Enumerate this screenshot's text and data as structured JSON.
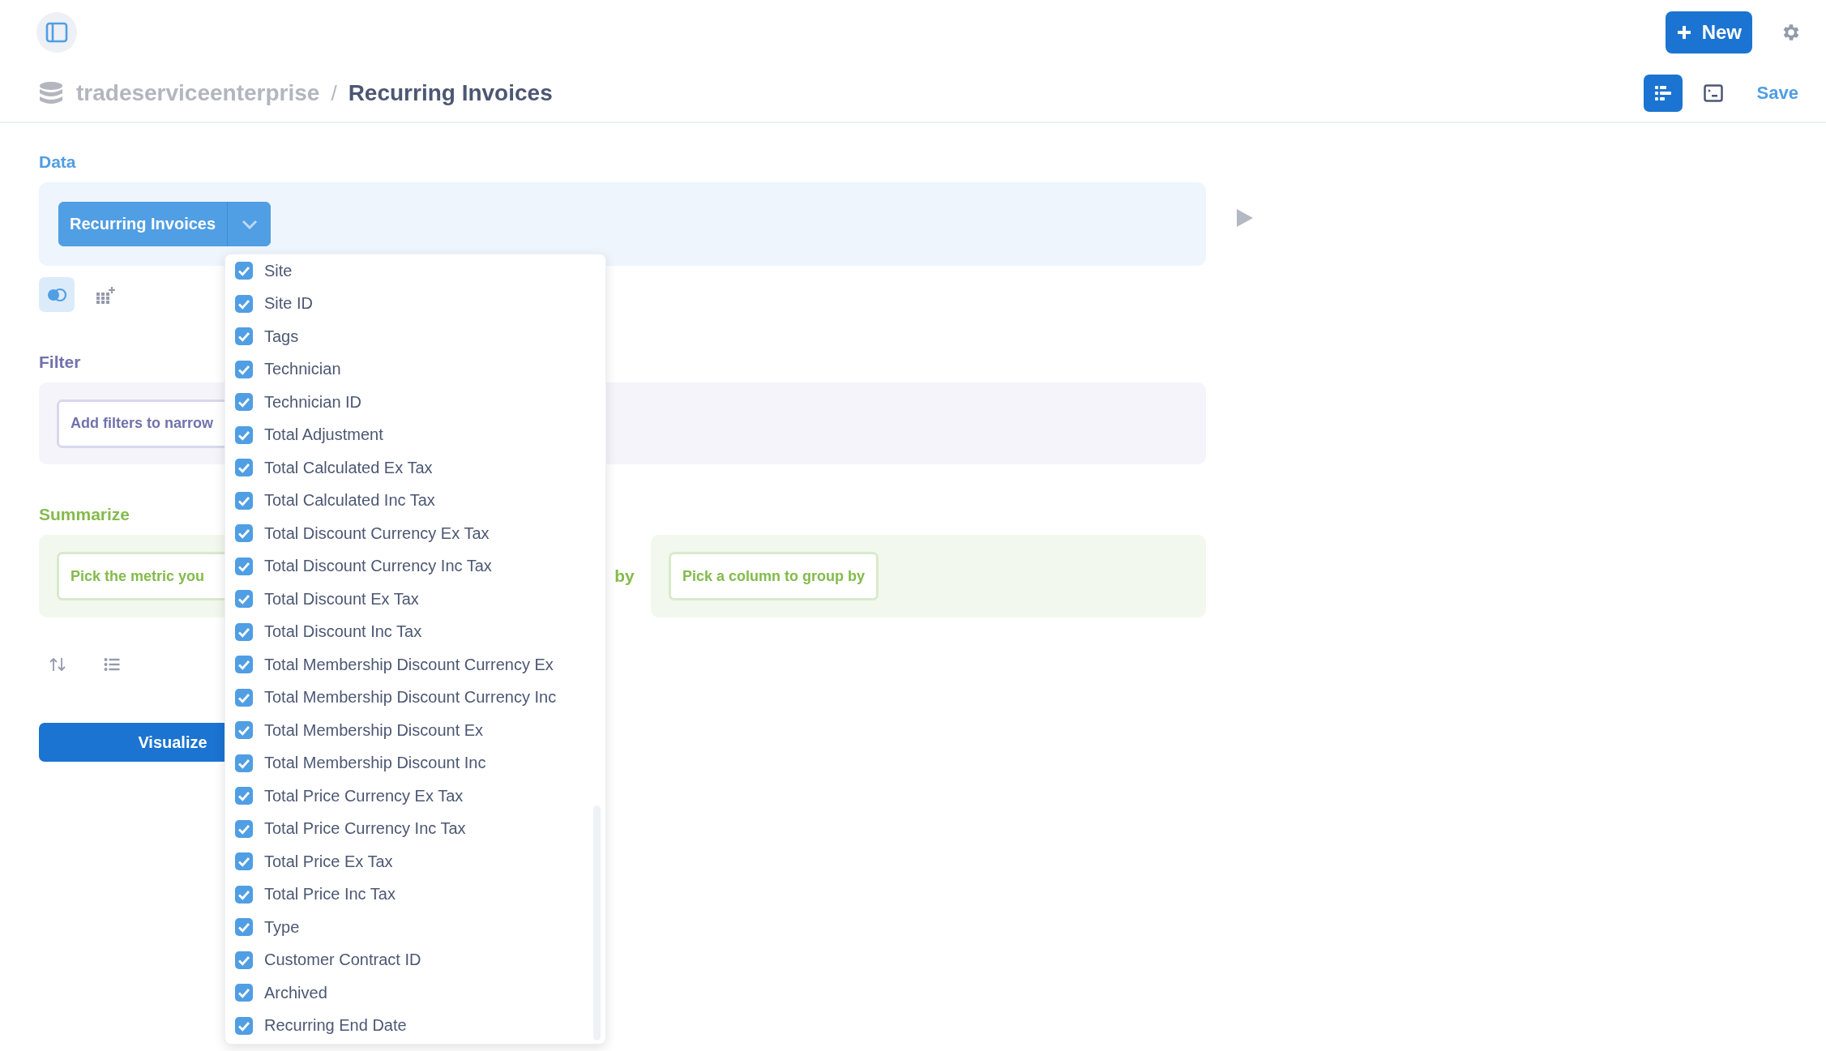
{
  "top_bar": {
    "new_button": "New"
  },
  "breadcrumb": {
    "database": "tradeserviceenterprise",
    "separator": "/",
    "question": "Recurring Invoices"
  },
  "view_toggle": [
    {
      "kind": "notebook",
      "selected": true
    },
    {
      "kind": "sql",
      "selected": false
    }
  ],
  "save_button": "Save",
  "data_step": {
    "label": "Data",
    "table_button": "Recurring Invoices"
  },
  "filter_step": {
    "label": "Filter",
    "button": "Add filters to narrow"
  },
  "summarize_step": {
    "label": "Summarize",
    "metric_button": "Pick the metric you",
    "by_label": "by",
    "group_button": "Pick a column to group by"
  },
  "visualize_button": "Visualize",
  "column_menu": {
    "items": [
      {
        "label": "Site",
        "checked": true
      },
      {
        "label": "Site ID",
        "checked": true
      },
      {
        "label": "Tags",
        "checked": true
      },
      {
        "label": "Technician",
        "checked": true
      },
      {
        "label": "Technician ID",
        "checked": true
      },
      {
        "label": "Total Adjustment",
        "checked": true
      },
      {
        "label": "Total Calculated Ex Tax",
        "checked": true
      },
      {
        "label": "Total Calculated Inc Tax",
        "checked": true
      },
      {
        "label": "Total Discount Currency Ex Tax",
        "checked": true
      },
      {
        "label": "Total Discount Currency Inc Tax",
        "checked": true
      },
      {
        "label": "Total Discount Ex Tax",
        "checked": true
      },
      {
        "label": "Total Discount Inc Tax",
        "checked": true
      },
      {
        "label": "Total Membership Discount Currency Ex",
        "checked": true
      },
      {
        "label": "Total Membership Discount Currency Inc",
        "checked": true
      },
      {
        "label": "Total Membership Discount Ex",
        "checked": true
      },
      {
        "label": "Total Membership Discount Inc",
        "checked": true
      },
      {
        "label": "Total Price Currency Ex Tax",
        "checked": true
      },
      {
        "label": "Total Price Currency Inc Tax",
        "checked": true
      },
      {
        "label": "Total Price Ex Tax",
        "checked": true
      },
      {
        "label": "Total Price Inc Tax",
        "checked": true
      },
      {
        "label": "Type",
        "checked": true
      },
      {
        "label": "Customer Contract ID",
        "checked": true
      },
      {
        "label": "Archived",
        "checked": true
      },
      {
        "label": "Recurring End Date",
        "checked": true
      }
    ]
  }
}
